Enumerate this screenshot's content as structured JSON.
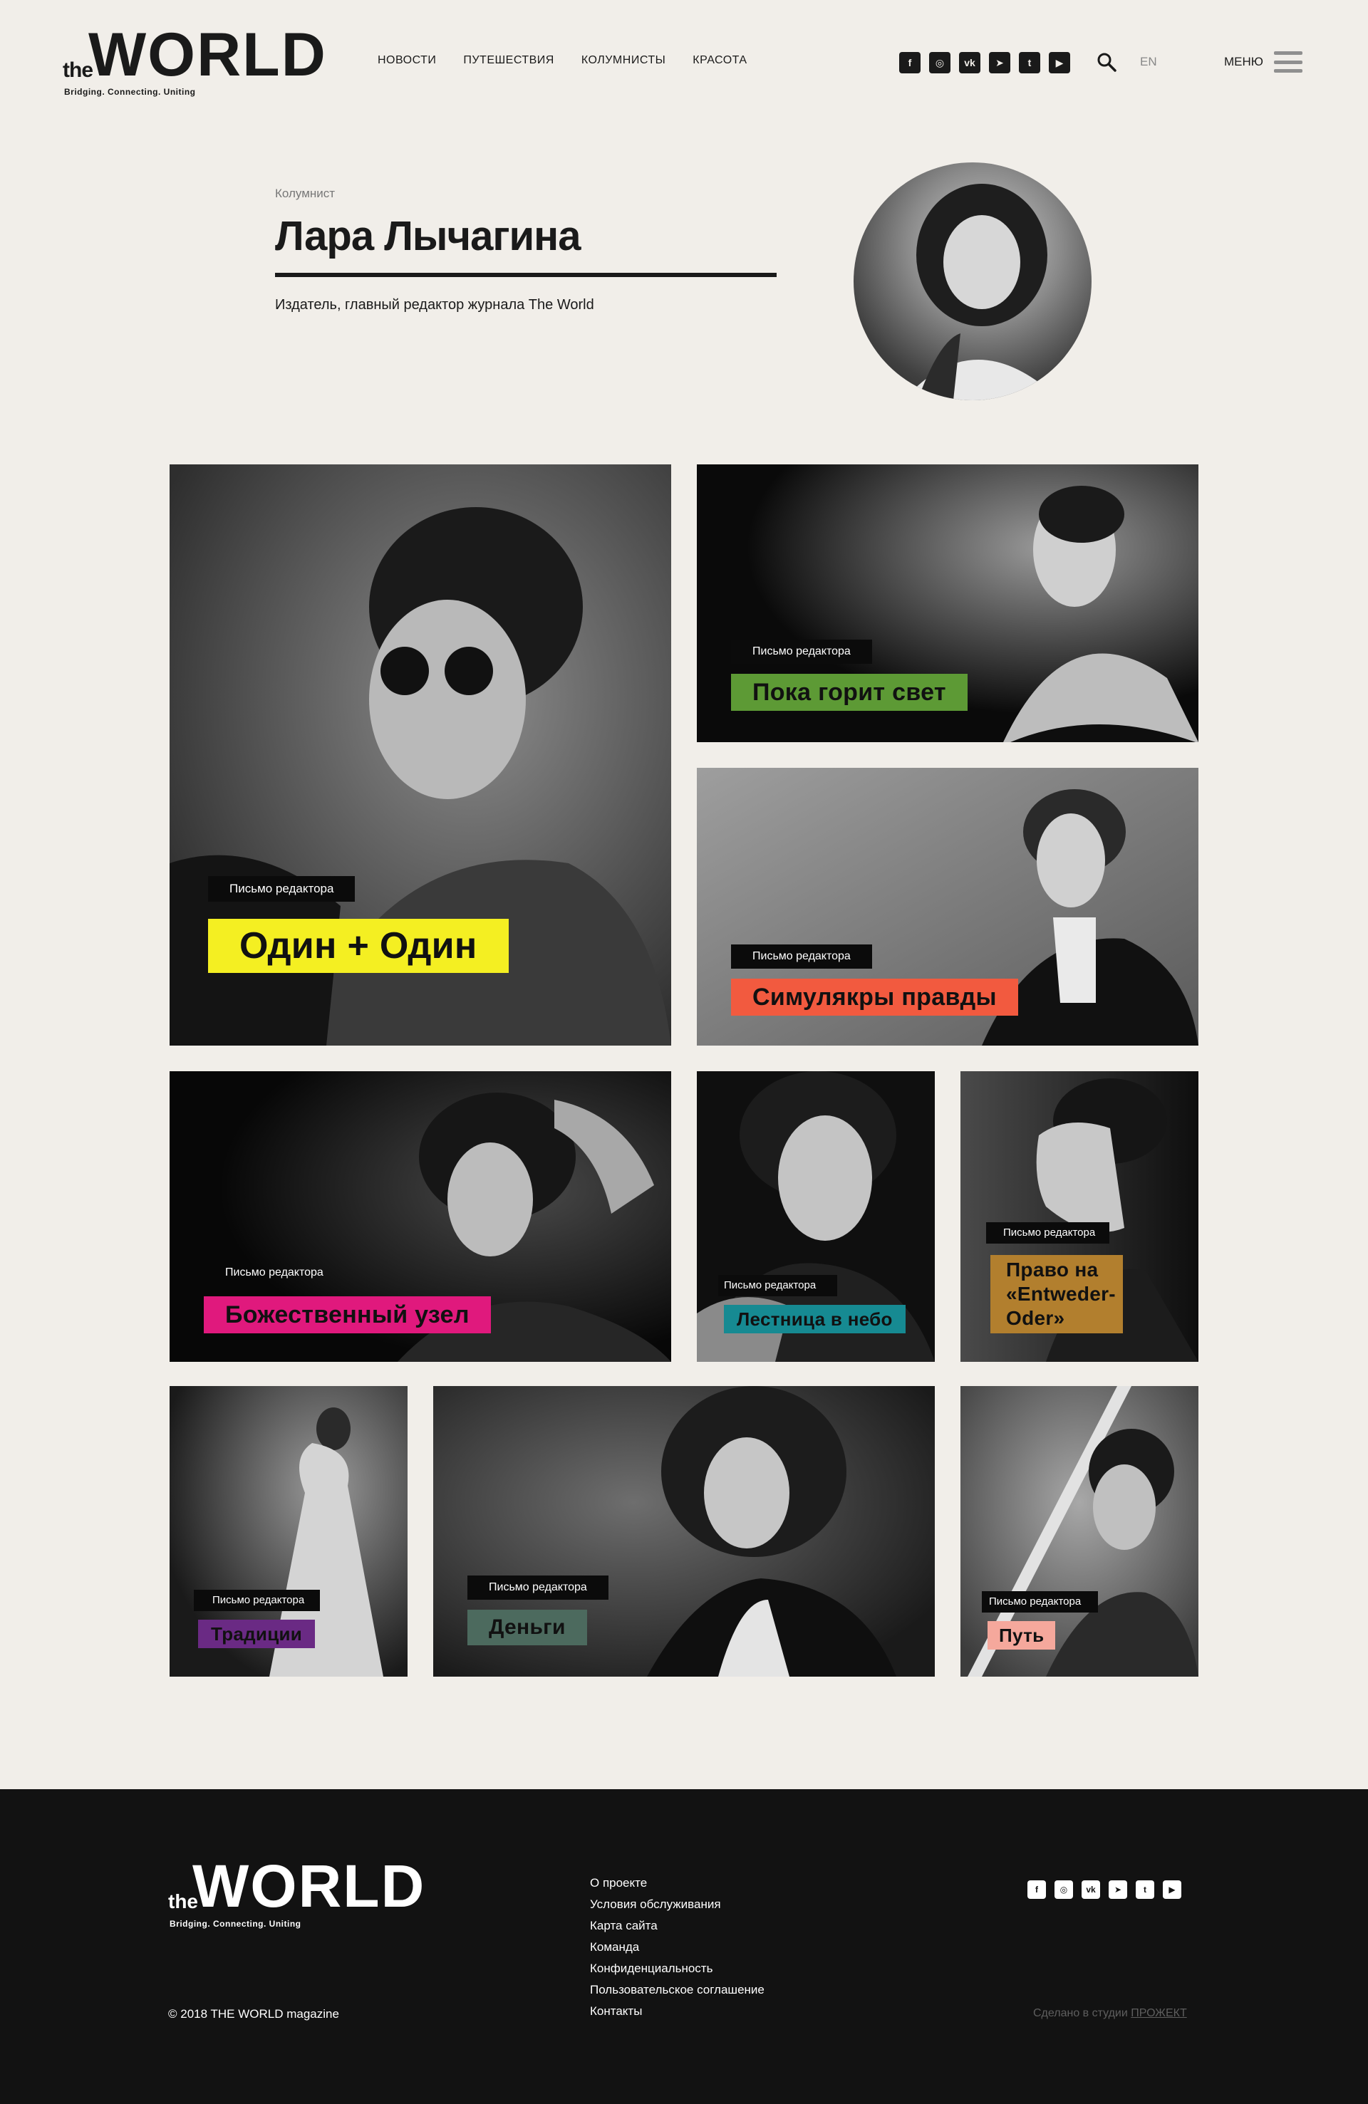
{
  "header": {
    "logo": {
      "the": "the",
      "world": "WORLD",
      "tagline": "Bridging. Connecting. Uniting"
    },
    "nav": [
      "НОВОСТИ",
      "ПУТЕШЕСТВИЯ",
      "КОЛУМНИСТЫ",
      "КРАСОТА"
    ],
    "social_icons": [
      "facebook-icon",
      "instagram-icon",
      "vk-icon",
      "telegram-icon",
      "twitter-icon",
      "youtube-icon"
    ],
    "lang": "EN",
    "menu_label": "МЕНЮ"
  },
  "author": {
    "role": "Колумнист",
    "name": "Лара Лычагина",
    "description": "Издатель, главный редактор журнала The World"
  },
  "cards": [
    {
      "kicker": "Письмо редактора",
      "title": "Один + Один",
      "accent": "#f4ef22"
    },
    {
      "kicker": "Письмо редактора",
      "title": "Пока горит свет",
      "accent": "#5d9a35"
    },
    {
      "kicker": "Письмо редактора",
      "title": "Симулякры правды",
      "accent": "#f25a3f"
    },
    {
      "kicker": "Письмо редактора",
      "title": "Божественный узел",
      "accent": "#e0197d"
    },
    {
      "kicker": "Письмо редактора",
      "title": "Лестница в небо",
      "accent": "#168a92"
    },
    {
      "kicker": "Письмо редактора",
      "title": "Право на «Entweder-Oder»",
      "accent": "#b27f2e"
    },
    {
      "kicker": "Письмо редактора",
      "title": "Традиции",
      "accent": "#6a2a84"
    },
    {
      "kicker": "Письмо редактора",
      "title": "Деньги",
      "accent": "#4c6a5e"
    },
    {
      "kicker": "Письмо редактора",
      "title": "Путь",
      "accent": "#f5a89c"
    }
  ],
  "footer": {
    "logo": {
      "the": "the",
      "world": "WORLD",
      "tagline": "Bridging. Connecting. Uniting"
    },
    "links": [
      "О проекте",
      "Условия обслуживания",
      "Карта сайта",
      "Команда",
      "Конфиденциальность",
      "Пользовательское соглашение",
      "Контакты"
    ],
    "copyright": "© 2018 THE WORLD magazine",
    "made_by": "Сделано в студии",
    "studio": "ПРОЖЕКТ"
  }
}
